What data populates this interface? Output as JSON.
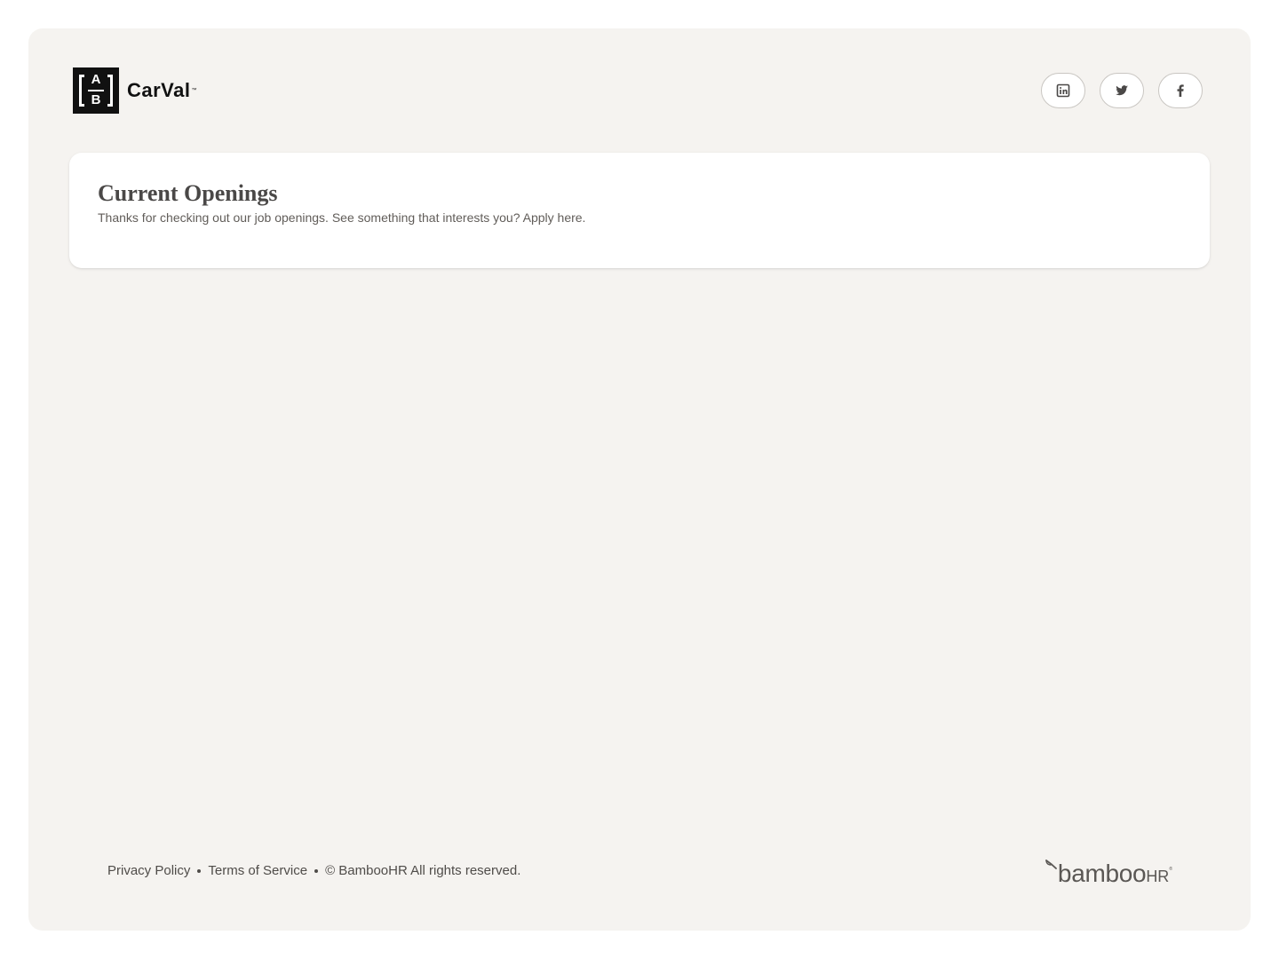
{
  "brand": {
    "mark_top_letter": "A",
    "mark_bottom_letter": "B",
    "wordmark": "CarVal",
    "trademark": "™"
  },
  "social": [
    {
      "name": "linkedin",
      "icon": "linkedin-icon"
    },
    {
      "name": "twitter",
      "icon": "twitter-icon"
    },
    {
      "name": "facebook",
      "icon": "facebook-icon"
    }
  ],
  "openings": {
    "title": "Current Openings",
    "subtitle": "Thanks for checking out our job openings. See something that interests you? Apply here."
  },
  "footer": {
    "privacy": "Privacy Policy",
    "terms": "Terms of Service",
    "copyright": "© BambooHR All rights reserved.",
    "powered_by_word": "bamboo",
    "powered_by_suffix": "HR",
    "powered_by_reg": "®"
  },
  "colors": {
    "page_background": "#f5f3f0",
    "card_background": "#ffffff",
    "text_primary": "#4a4847",
    "text_secondary": "#615d59"
  }
}
